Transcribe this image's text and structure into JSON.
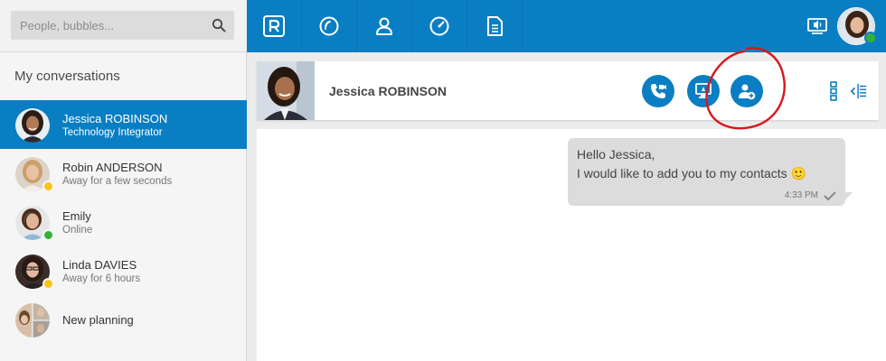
{
  "search": {
    "placeholder": "People, bubbles..."
  },
  "sidebar": {
    "section_title": "My conversations",
    "conversations": [
      {
        "name": "Jessica ROBINSON",
        "subtitle": "Technology Integrator",
        "active": true
      },
      {
        "name": "Robin ANDERSON",
        "subtitle": "Away for a few seconds",
        "status": "away"
      },
      {
        "name": "Emily",
        "subtitle": "Online",
        "status": "online"
      },
      {
        "name": "Linda DAVIES",
        "subtitle": "Away for 6 hours",
        "status": "away"
      },
      {
        "name": "New planning",
        "subtitle": ""
      }
    ]
  },
  "topbar": {
    "nav_icons": [
      "rainbow-logo-icon",
      "recent-icon",
      "contacts-icon",
      "dashboard-icon",
      "files-icon"
    ],
    "right_icon": "screen-share-icon",
    "user_status": "online"
  },
  "conversation": {
    "contact_name": "Jessica ROBINSON",
    "actions": [
      "call-video-icon",
      "share-screen-icon",
      "add-contact-icon"
    ],
    "side_icons": [
      "more-options-icon",
      "toggle-panel-icon"
    ]
  },
  "message": {
    "line1": "Hello Jessica,",
    "line2": "I would like to add you to my contacts",
    "emoji": "🙂",
    "time": "4:33 PM"
  },
  "colors": {
    "brand_blue": "#0a7ec2",
    "away": "#f5c518",
    "online": "#34b233",
    "annotation": "#d9161c"
  }
}
